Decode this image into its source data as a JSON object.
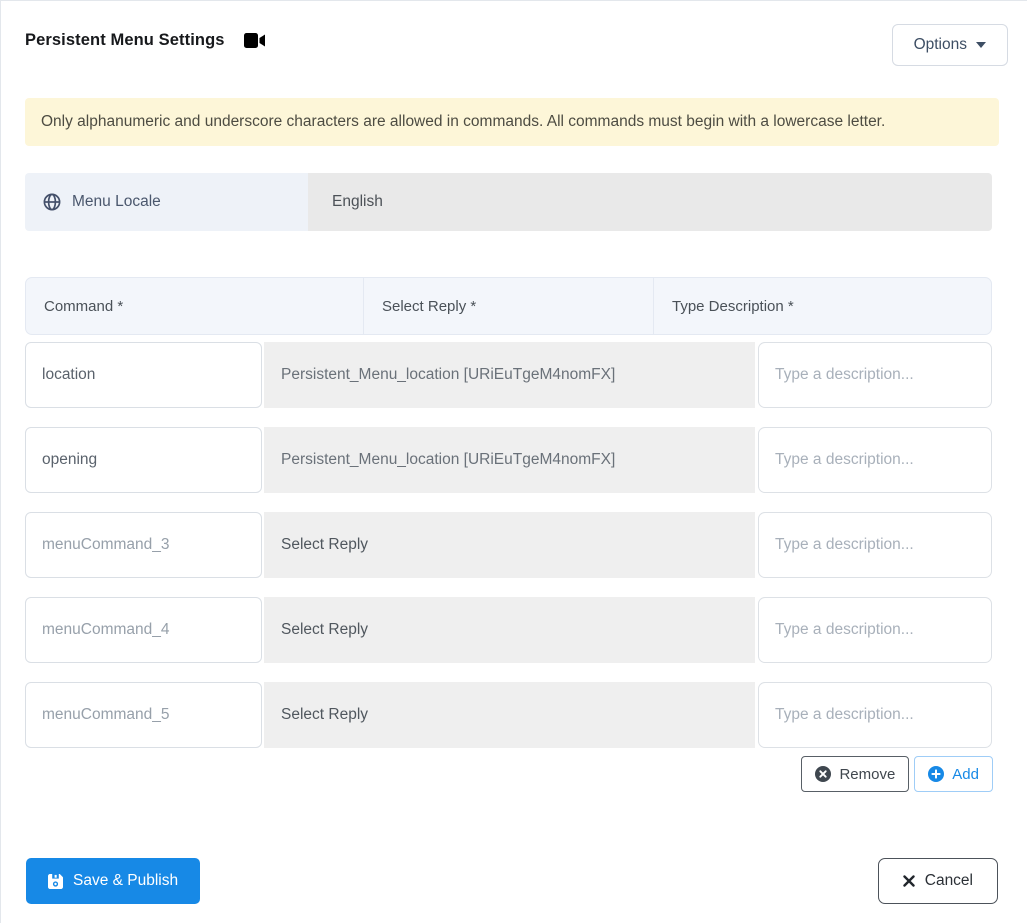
{
  "header": {
    "title": "Persistent Menu Settings",
    "options_label": "Options"
  },
  "banner": {
    "text": "Only alphanumeric and underscore characters are allowed in commands. All commands must begin with a lowercase letter."
  },
  "locale": {
    "label": "Menu Locale",
    "value": "English"
  },
  "table": {
    "headers": [
      "Command *",
      "Select Reply *",
      "Type Description *"
    ],
    "description_placeholder": "Type a description...",
    "rows": [
      {
        "command": "location",
        "command_state": "filled",
        "reply": "Persistent_Menu_location [URiEuTgeM4nomFX]",
        "reply_state": "filled"
      },
      {
        "command": "opening",
        "command_state": "filled",
        "reply": "Persistent_Menu_location [URiEuTgeM4nomFX]",
        "reply_state": "filled"
      },
      {
        "command": "menuCommand_3",
        "command_state": "default",
        "reply": "Select Reply",
        "reply_state": "empty"
      },
      {
        "command": "menuCommand_4",
        "command_state": "default",
        "reply": "Select Reply",
        "reply_state": "empty"
      },
      {
        "command": "menuCommand_5",
        "command_state": "default",
        "reply": "Select Reply",
        "reply_state": "empty"
      }
    ]
  },
  "actions": {
    "remove_label": "Remove",
    "add_label": "Add"
  },
  "footer": {
    "save_label": "Save & Publish",
    "cancel_label": "Cancel"
  },
  "colors": {
    "primary": "#1789e6",
    "banner_bg": "#fdf6d8",
    "header_bg": "#f3f6fb",
    "select_bg": "#efefef",
    "locale_label_bg": "#eef2f8",
    "locale_value_bg": "#e9e9e9"
  }
}
